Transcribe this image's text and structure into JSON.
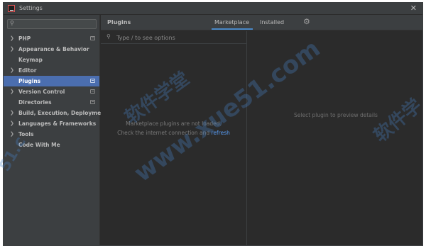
{
  "window": {
    "title": "Settings",
    "close_glyph": "✕"
  },
  "sidebar": {
    "search_value": "",
    "search_placeholder": "",
    "search_icon": "search-icon",
    "items": [
      {
        "label": "PHP",
        "expandable": true,
        "badge": true,
        "selected": false
      },
      {
        "label": "Appearance & Behavior",
        "expandable": true,
        "badge": false,
        "selected": false
      },
      {
        "label": "Keymap",
        "expandable": false,
        "badge": false,
        "selected": false
      },
      {
        "label": "Editor",
        "expandable": true,
        "badge": false,
        "selected": false
      },
      {
        "label": "Plugins",
        "expandable": false,
        "badge": true,
        "selected": true
      },
      {
        "label": "Version Control",
        "expandable": true,
        "badge": true,
        "selected": false
      },
      {
        "label": "Directories",
        "expandable": false,
        "badge": true,
        "selected": false
      },
      {
        "label": "Build, Execution, Deployment",
        "expandable": true,
        "badge": false,
        "selected": false
      },
      {
        "label": "Languages & Frameworks",
        "expandable": true,
        "badge": false,
        "selected": false
      },
      {
        "label": "Tools",
        "expandable": true,
        "badge": false,
        "selected": false
      },
      {
        "label": "Code With Me",
        "expandable": false,
        "badge": false,
        "selected": false
      }
    ]
  },
  "header": {
    "title": "Plugins",
    "tabs": [
      {
        "label": "Marketplace",
        "active": true
      },
      {
        "label": "Installed",
        "active": false
      }
    ],
    "settings_icon": "gear-icon"
  },
  "plugin_list": {
    "search_placeholder": "Type / to see options",
    "empty_line1": "Marketplace plugins are not loaded.",
    "empty_line2_prefix": "Check the internet connection and ",
    "refresh_link": "refresh"
  },
  "details": {
    "placeholder": "Select plugin to preview details"
  },
  "watermark": {
    "url": "www.xue51.com",
    "cn": "软件学堂",
    "cn_right": "软件学",
    "left": "51.c"
  },
  "colors": {
    "selection": "#4b6eaf",
    "link": "#589df6",
    "tab_underline": "#4a88c7",
    "panel": "#3c3f41",
    "background": "#2b2b2b"
  }
}
